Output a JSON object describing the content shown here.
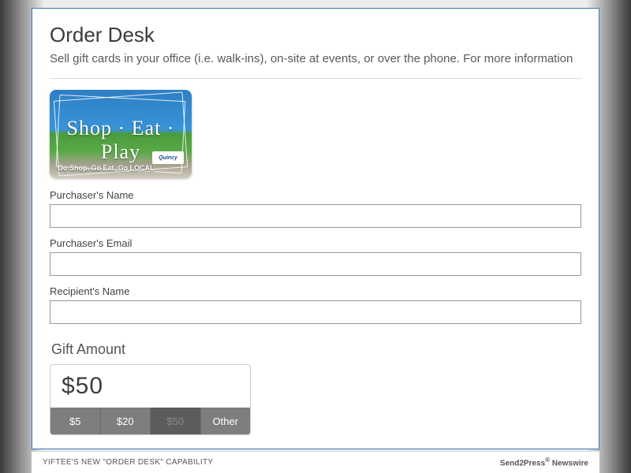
{
  "header": {
    "title": "Order Desk",
    "subtitle": "Sell gift cards in your office (i.e. walk-ins), on-site at events, or over the phone. For more information"
  },
  "giftcard": {
    "title_line": "Shop · Eat · Play",
    "subtitle": "Go Shop. Go Eat. Go LOCAL",
    "logo_text": "Quincy"
  },
  "fields": {
    "purchaser_name": {
      "label": "Purchaser's Name",
      "value": ""
    },
    "purchaser_email": {
      "label": "Purchaser's Email",
      "value": ""
    },
    "recipient_name": {
      "label": "Recipient's Name",
      "value": ""
    }
  },
  "gift_amount": {
    "label": "Gift Amount",
    "display": "$50",
    "options": [
      "$5",
      "$20",
      "$50",
      "Other"
    ],
    "selected_index": 2
  },
  "footer": {
    "left": "YIFTEE'S NEW \"ORDER DESK\" CAPABILITY",
    "right_brand": "Send2Press",
    "right_suffix": " Newswire"
  }
}
